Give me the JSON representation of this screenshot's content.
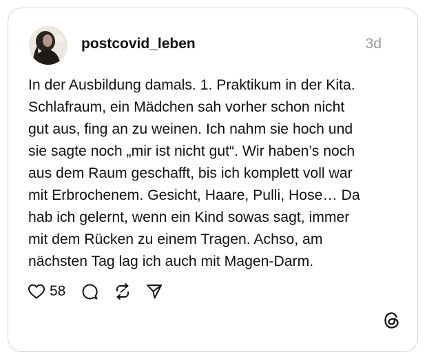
{
  "post": {
    "username": "postcovid_leben",
    "timestamp": "3d",
    "lines": [
      "In der Ausbildung damals. 1. Praktikum in der Kita.",
      "Schlafraum, ein Mädchen sah vorher schon nicht",
      "gut aus, fing an zu weinen. Ich nahm sie hoch und",
      "sie sagte noch „mir ist nicht gut“. Wir haben’s noch",
      "aus dem Raum geschafft, bis ich komplett voll war",
      "mit Erbrochenem. Gesicht, Haare, Pulli, Hose… Da",
      "hab ich gelernt, wenn ein Kind sowas sagt, immer",
      "mit dem Rücken zu einem Tragen. Achso, am",
      "nächsten Tag lag ich auch mit Magen-Darm."
    ]
  },
  "actions": {
    "like_count": "58",
    "icons": [
      "heart-icon",
      "comment-icon",
      "repost-icon",
      "share-icon"
    ]
  },
  "brand": {
    "logo": "threads-logo-icon"
  },
  "colors": {
    "text": "#111111",
    "muted": "#9a9a9a",
    "border": "#d6d6d6"
  }
}
